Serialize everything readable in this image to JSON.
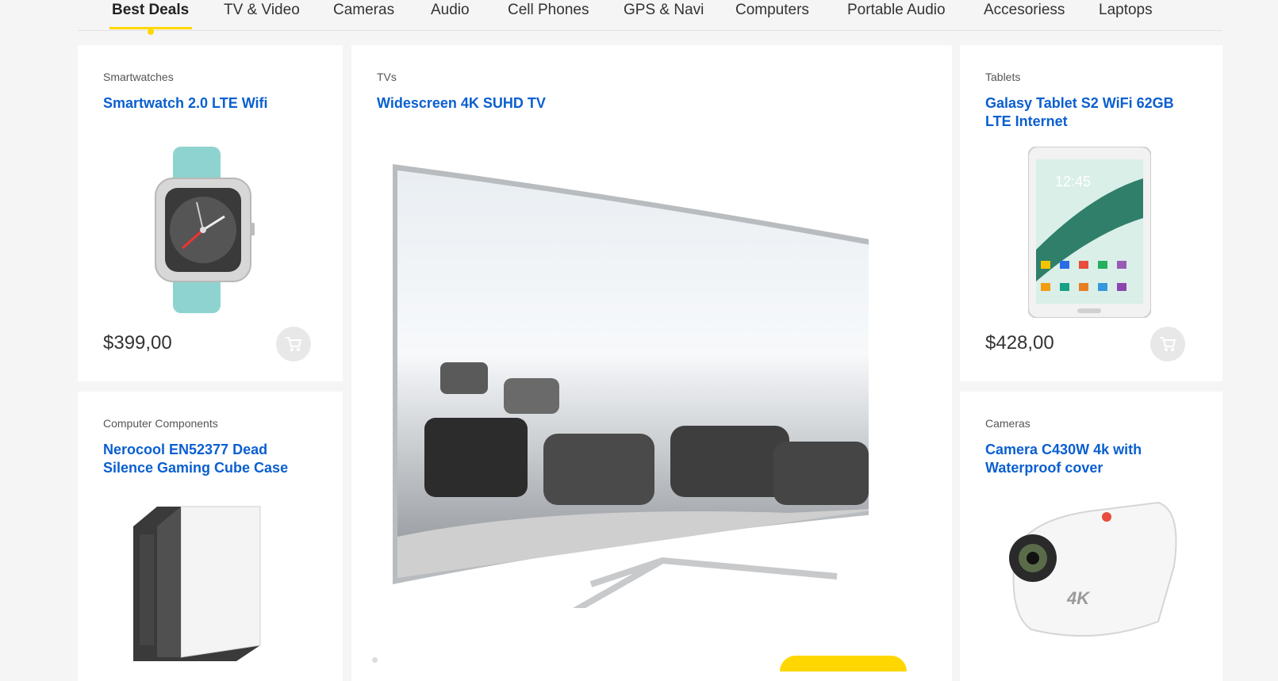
{
  "tabs": [
    {
      "label": "Best Deals",
      "active": true
    },
    {
      "label": "TV & Video"
    },
    {
      "label": "Cameras"
    },
    {
      "label": "Audio"
    },
    {
      "label": "Cell Phones"
    },
    {
      "label": "GPS & Navi"
    },
    {
      "label": "Computers"
    },
    {
      "label": "Portable Audio"
    },
    {
      "label": "Accesoriess"
    },
    {
      "label": "Laptops"
    }
  ],
  "products": {
    "smartwatch": {
      "category": "Smartwatches",
      "title": "Smartwatch 2.0 LTE Wifi",
      "price": "$399,00"
    },
    "tv": {
      "category": "TVs",
      "title": "Widescreen 4K SUHD TV"
    },
    "tablet": {
      "category": "Tablets",
      "title_line1": "Galasy Tablet S2 WiFi 62GB",
      "title_line2": "LTE Internet",
      "price": "$428,00",
      "screen_time": "12:45"
    },
    "case": {
      "category": "Computer Components",
      "title_line1": "Nerocool EN52377 Dead",
      "title_line2": "Silence Gaming Cube Case"
    },
    "camera": {
      "category": "Cameras",
      "title_line1": "Camera C430W 4k with",
      "title_line2": "Waterproof cover",
      "badge": "4K"
    }
  },
  "colors": {
    "accent": "#fed700",
    "link": "#0a5fd0"
  },
  "icons": {
    "cart": "cart-icon"
  }
}
